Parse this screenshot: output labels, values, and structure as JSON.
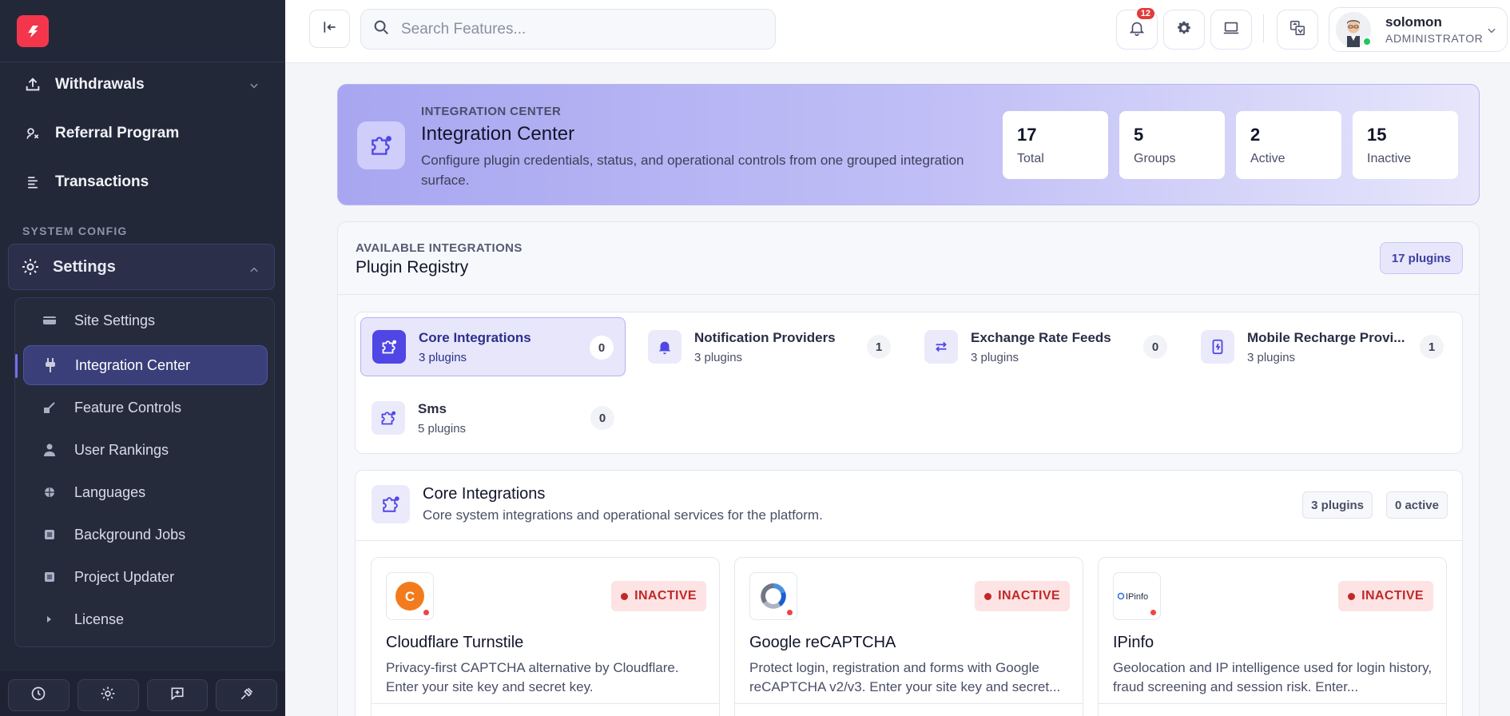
{
  "sidebar": {
    "items": [
      {
        "label": "Withdrawals",
        "icon": "upload-icon"
      },
      {
        "label": "Referral Program",
        "icon": "referral-icon"
      },
      {
        "label": "Transactions",
        "icon": "list-icon"
      }
    ],
    "section_label": "SYSTEM CONFIG",
    "settings_label": "Settings",
    "sub_items": [
      {
        "label": "Site Settings",
        "icon": "card-icon"
      },
      {
        "label": "Integration Center",
        "icon": "plug-icon"
      },
      {
        "label": "Feature Controls",
        "icon": "sliders-icon"
      },
      {
        "label": "User Rankings",
        "icon": "user-icon"
      },
      {
        "label": "Languages",
        "icon": "globe-icon"
      },
      {
        "label": "Background Jobs",
        "icon": "square-icon"
      },
      {
        "label": "Project Updater",
        "icon": "square-icon"
      },
      {
        "label": "License",
        "icon": "caret-icon"
      }
    ]
  },
  "topbar": {
    "search_placeholder": "Search Features...",
    "notification_count": "12",
    "user": {
      "name": "solomon",
      "role": "ADMINISTRATOR"
    }
  },
  "hero": {
    "eyebrow": "INTEGRATION CENTER",
    "title": "Integration Center",
    "description": "Configure plugin credentials, status, and operational controls from one grouped integration surface.",
    "stats": [
      {
        "value": "17",
        "label": "Total"
      },
      {
        "value": "5",
        "label": "Groups"
      },
      {
        "value": "2",
        "label": "Active"
      },
      {
        "value": "15",
        "label": "Inactive"
      }
    ]
  },
  "registry": {
    "eyebrow": "AVAILABLE INTEGRATIONS",
    "title": "Plugin Registry",
    "pill": "17 plugins",
    "groups": [
      {
        "name": "Core Integrations",
        "count": "3 plugins",
        "badge": "0"
      },
      {
        "name": "Notification Providers",
        "count": "3 plugins",
        "badge": "1"
      },
      {
        "name": "Exchange Rate Feeds",
        "count": "3 plugins",
        "badge": "0"
      },
      {
        "name": "Mobile Recharge Provi...",
        "count": "3 plugins",
        "badge": "1"
      },
      {
        "name": "Sms",
        "count": "5 plugins",
        "badge": "0"
      }
    ]
  },
  "core": {
    "title": "Core Integrations",
    "description": "Core system integrations and operational services for the platform.",
    "pill_plugins": "3 plugins",
    "pill_active": "0 active",
    "cards": [
      {
        "name": "Cloudflare Turnstile",
        "status": "INACTIVE",
        "logo_text": "C",
        "description": "Privacy-first CAPTCHA alternative by Cloudflare. Enter your site key and secret key."
      },
      {
        "name": "Google reCAPTCHA",
        "status": "INACTIVE",
        "logo_text": "",
        "description": "Protect login, registration and forms with Google reCAPTCHA v2/v3. Enter your site key and secret..."
      },
      {
        "name": "IPinfo",
        "status": "INACTIVE",
        "logo_text": "IPinfo",
        "description": "Geolocation and IP intelligence used for login history, fraud screening and session risk. Enter..."
      }
    ]
  },
  "colors": {
    "accent": "#4f46e5",
    "sidebar_bg": "#232839",
    "inactive": "#c02929"
  }
}
